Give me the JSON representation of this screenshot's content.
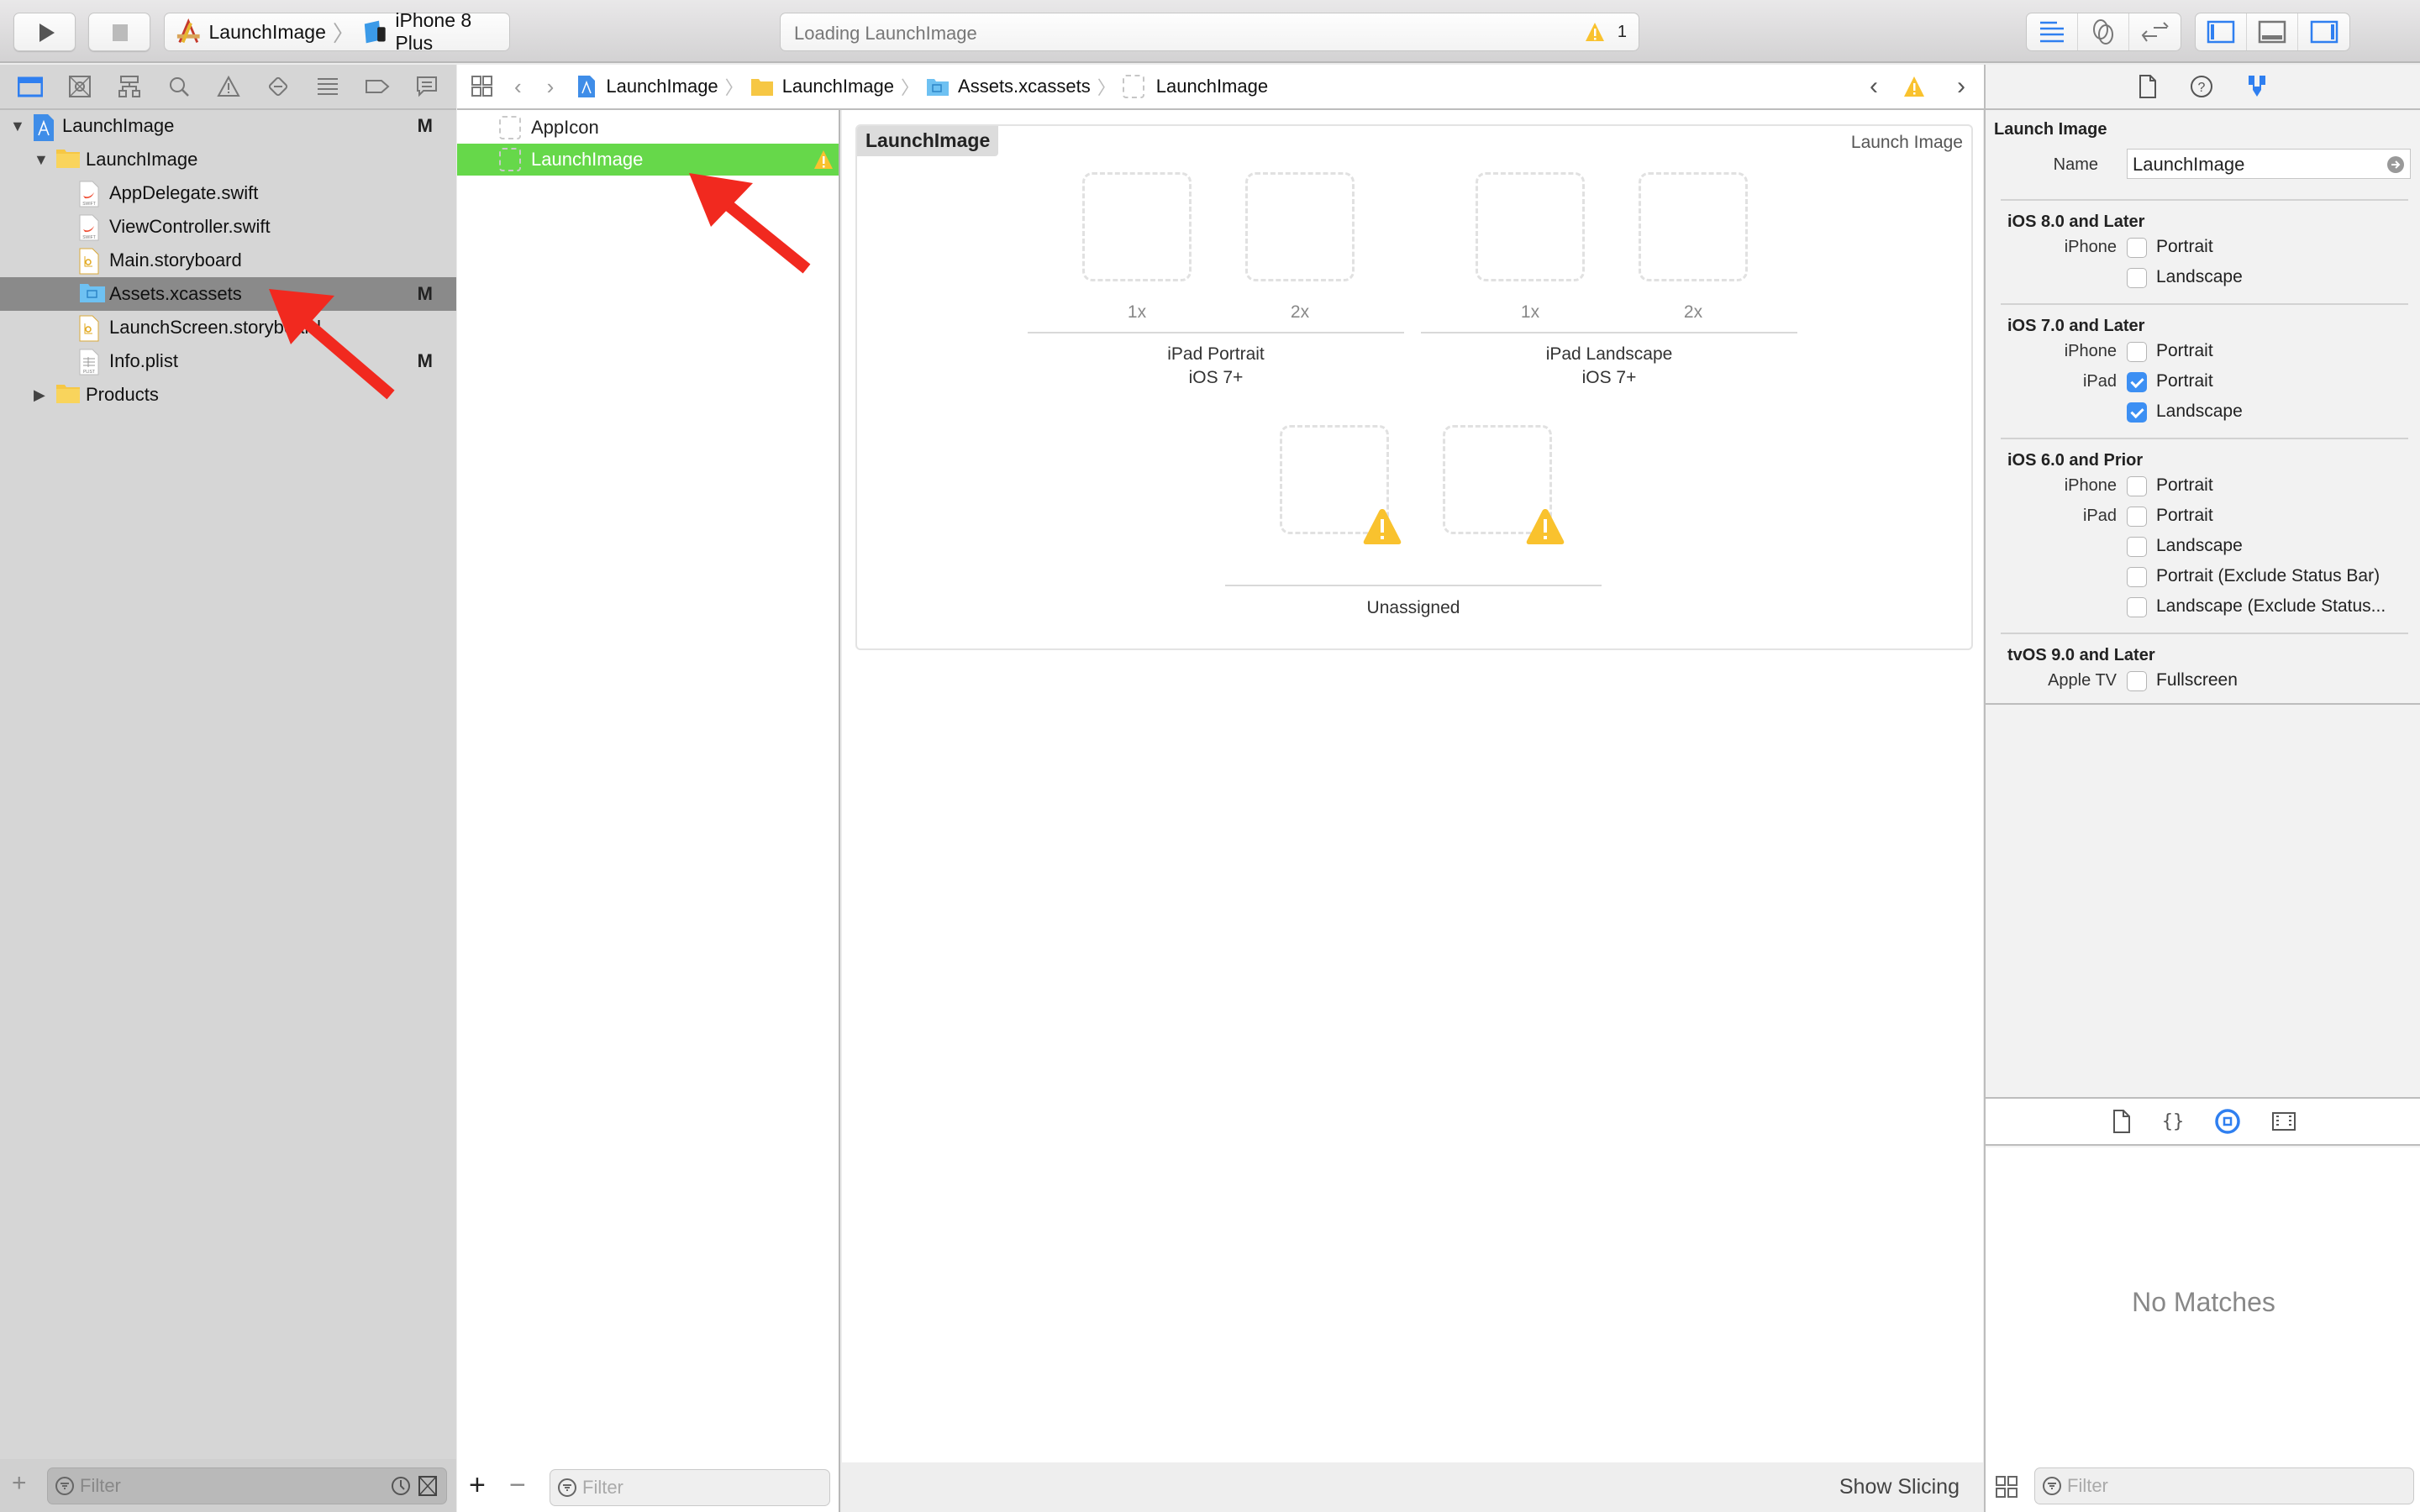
{
  "toolbar": {
    "run_button": "run",
    "stop_button": "stop",
    "scheme": {
      "project": "LaunchImage",
      "device": "iPhone 8 Plus"
    },
    "activity": {
      "status": "Loading LaunchImage",
      "warning_count": "1"
    },
    "editor_modes": [
      "standard-editor",
      "assistant-editor",
      "version-editor"
    ],
    "view_toggles": [
      "navigator",
      "debug-area",
      "utilities"
    ]
  },
  "navigator": {
    "tabs": [
      "project",
      "source-control",
      "symbol",
      "find",
      "issue",
      "test",
      "debug",
      "breakpoint",
      "report"
    ],
    "tree": [
      {
        "label": "LaunchImage",
        "badge": "M",
        "icon": "xcode-project",
        "level": 0,
        "disclosure": "open"
      },
      {
        "label": "LaunchImage",
        "badge": "",
        "icon": "folder",
        "level": 1,
        "disclosure": "open"
      },
      {
        "label": "AppDelegate.swift",
        "badge": "",
        "icon": "swift-file",
        "level": 2
      },
      {
        "label": "ViewController.swift",
        "badge": "",
        "icon": "swift-file",
        "level": 2
      },
      {
        "label": "Main.storyboard",
        "badge": "",
        "icon": "storyboard-file",
        "level": 2
      },
      {
        "label": "Assets.xcassets",
        "badge": "M",
        "icon": "asset-catalog",
        "level": 2,
        "selected": true
      },
      {
        "label": "LaunchScreen.storyboard",
        "badge": "",
        "icon": "storyboard-file",
        "level": 2
      },
      {
        "label": "Info.plist",
        "badge": "M",
        "icon": "plist-file",
        "level": 2
      },
      {
        "label": "Products",
        "badge": "",
        "icon": "folder",
        "level": 1,
        "disclosure": "closed"
      }
    ],
    "filter_placeholder": "Filter"
  },
  "jumpbar": {
    "crumbs": [
      "LaunchImage",
      "LaunchImage",
      "Assets.xcassets",
      "LaunchImage"
    ]
  },
  "asset_list": {
    "items": [
      {
        "label": "AppIcon",
        "selected": false,
        "warning": false
      },
      {
        "label": "LaunchImage",
        "selected": true,
        "warning": true
      }
    ],
    "filter_placeholder": "Filter"
  },
  "editor": {
    "set_name": "LaunchImage",
    "set_type": "Launch Image",
    "groups": [
      {
        "title": "iPad Portrait",
        "subtitle": "iOS 7+",
        "slots": [
          "1x",
          "2x"
        ]
      },
      {
        "title": "iPad Landscape",
        "subtitle": "iOS 7+",
        "slots": [
          "1x",
          "2x"
        ]
      },
      {
        "title": "Unassigned",
        "subtitle": "",
        "slots": [
          "",
          ""
        ]
      }
    ],
    "show_slicing": "Show Slicing"
  },
  "inspector": {
    "section": "Launch Image",
    "name_label": "Name",
    "name_value": "LaunchImage",
    "groups": [
      {
        "title": "iOS 8.0 and Later",
        "options": [
          {
            "device": "iPhone",
            "label": "Portrait",
            "checked": false
          },
          {
            "device": "",
            "label": "Landscape",
            "checked": false
          }
        ]
      },
      {
        "title": "iOS 7.0 and Later",
        "options": [
          {
            "device": "iPhone",
            "label": "Portrait",
            "checked": false
          },
          {
            "device": "iPad",
            "label": "Portrait",
            "checked": true
          },
          {
            "device": "",
            "label": "Landscape",
            "checked": true
          }
        ]
      },
      {
        "title": "iOS 6.0 and Prior",
        "options": [
          {
            "device": "iPhone",
            "label": "Portrait",
            "checked": false
          },
          {
            "device": "iPad",
            "label": "Portrait",
            "checked": false
          },
          {
            "device": "",
            "label": "Landscape",
            "checked": false
          },
          {
            "device": "",
            "label": "Portrait (Exclude Status Bar)",
            "checked": false
          },
          {
            "device": "",
            "label": "Landscape (Exclude Status...",
            "checked": false
          }
        ]
      },
      {
        "title": "tvOS 9.0 and Later",
        "options": [
          {
            "device": "Apple TV",
            "label": "Fullscreen",
            "checked": false
          }
        ]
      }
    ],
    "library_empty": "No Matches",
    "filter_placeholder": "Filter"
  },
  "colors": {
    "selection_green": "#66d84a",
    "accent_blue": "#2f7ff0",
    "warning_yellow": "#f9c22e",
    "annotation_red": "#f1291f"
  }
}
